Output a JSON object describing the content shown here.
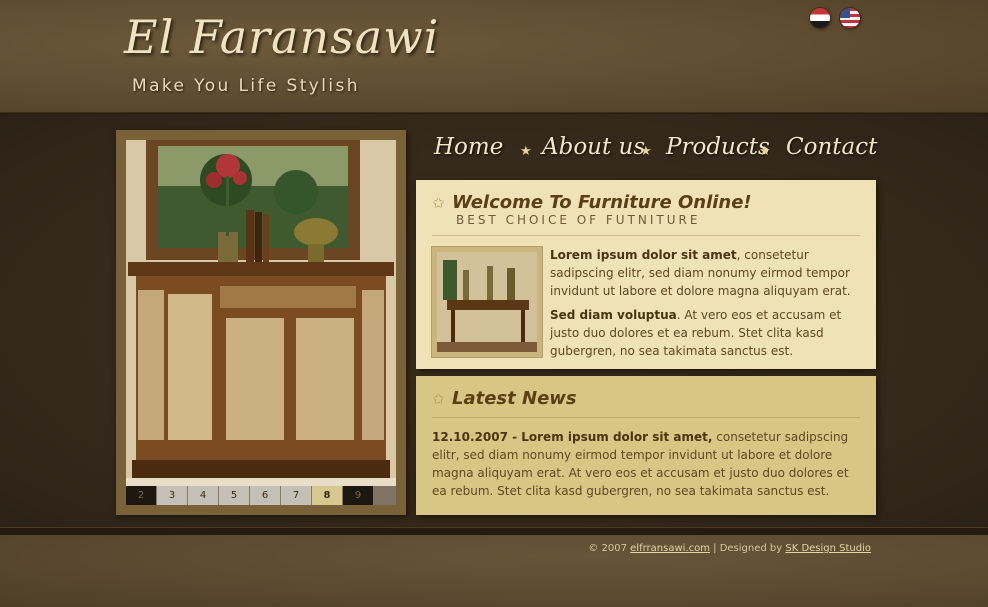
{
  "header": {
    "logo_title": "El Faransawi",
    "logo_tagline": "Make You Life Stylish",
    "flags": [
      "egypt-flag-icon",
      "us-flag-icon"
    ]
  },
  "nav": {
    "items": [
      "Home",
      "About us",
      "Products",
      "Contact"
    ],
    "separator_icon": "star-icon"
  },
  "showcase": {
    "pager": [
      "2",
      "3",
      "4",
      "5",
      "6",
      "7",
      "8",
      "9"
    ],
    "active_page": "8"
  },
  "welcome": {
    "title": "Welcome To Furniture Online!",
    "subtitle": "BEST CHOICE OF FUTNITURE",
    "para1_bold": "Lorem ipsum dolor sit amet",
    "para1_rest": ", consetetur sadipscing elitr, sed diam nonumy eirmod tempor invidunt ut labore et dolore magna aliquyam erat.",
    "para2_bold": "Sed diam voluptua",
    "para2_rest": ". At vero eos et accusam et justo duo dolores et ea rebum. Stet clita kasd gubergren, no sea takimata sanctus est."
  },
  "news": {
    "title": "Latest News",
    "item_bold": "12.10.2007 - Lorem ipsum dolor sit amet,",
    "item_rest": " consetetur sadipscing elitr, sed diam nonumy eirmod tempor invidunt ut labore et dolore magna aliquyam erat. At vero eos et accusam et justo duo dolores et ea rebum. Stet clita kasd gubergren, no sea takimata sanctus est."
  },
  "footer": {
    "copyright": "© 2007",
    "site_link": "elfrransawi.com",
    "separator": "| Designed by",
    "designer_link": "SK Design Studio"
  },
  "colors": {
    "header_bg": "#5e4c31",
    "band_bg": "#33281a",
    "welcome_bg": "#efe2b6",
    "news_bg": "#d8c684",
    "title_color": "#5a3f14"
  }
}
